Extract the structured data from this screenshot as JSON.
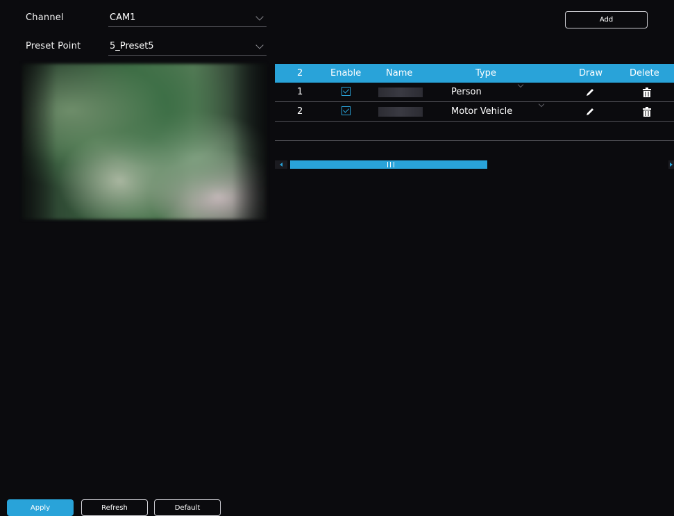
{
  "form": {
    "channel_label": "Channel",
    "channel_value": "CAM1",
    "preset_label": "Preset Point",
    "preset_value": "5_Preset5"
  },
  "toolbar": {
    "add_label": "Add"
  },
  "table": {
    "headers": {
      "count": "2",
      "enable": "Enable",
      "name": "Name",
      "type": "Type",
      "draw": "Draw",
      "delete": "Delete"
    },
    "rows": [
      {
        "index": "1",
        "type": "Person"
      },
      {
        "index": "2",
        "type": "Motor Vehicle"
      }
    ]
  },
  "footer": {
    "apply": "Apply",
    "refresh": "Refresh",
    "default": "Default"
  },
  "colors": {
    "accent": "#29a3d9",
    "background": "#0b0b0e"
  },
  "icons": {
    "enable": "checkbox-checked-icon",
    "draw": "pencil-icon",
    "delete": "trash-icon"
  }
}
